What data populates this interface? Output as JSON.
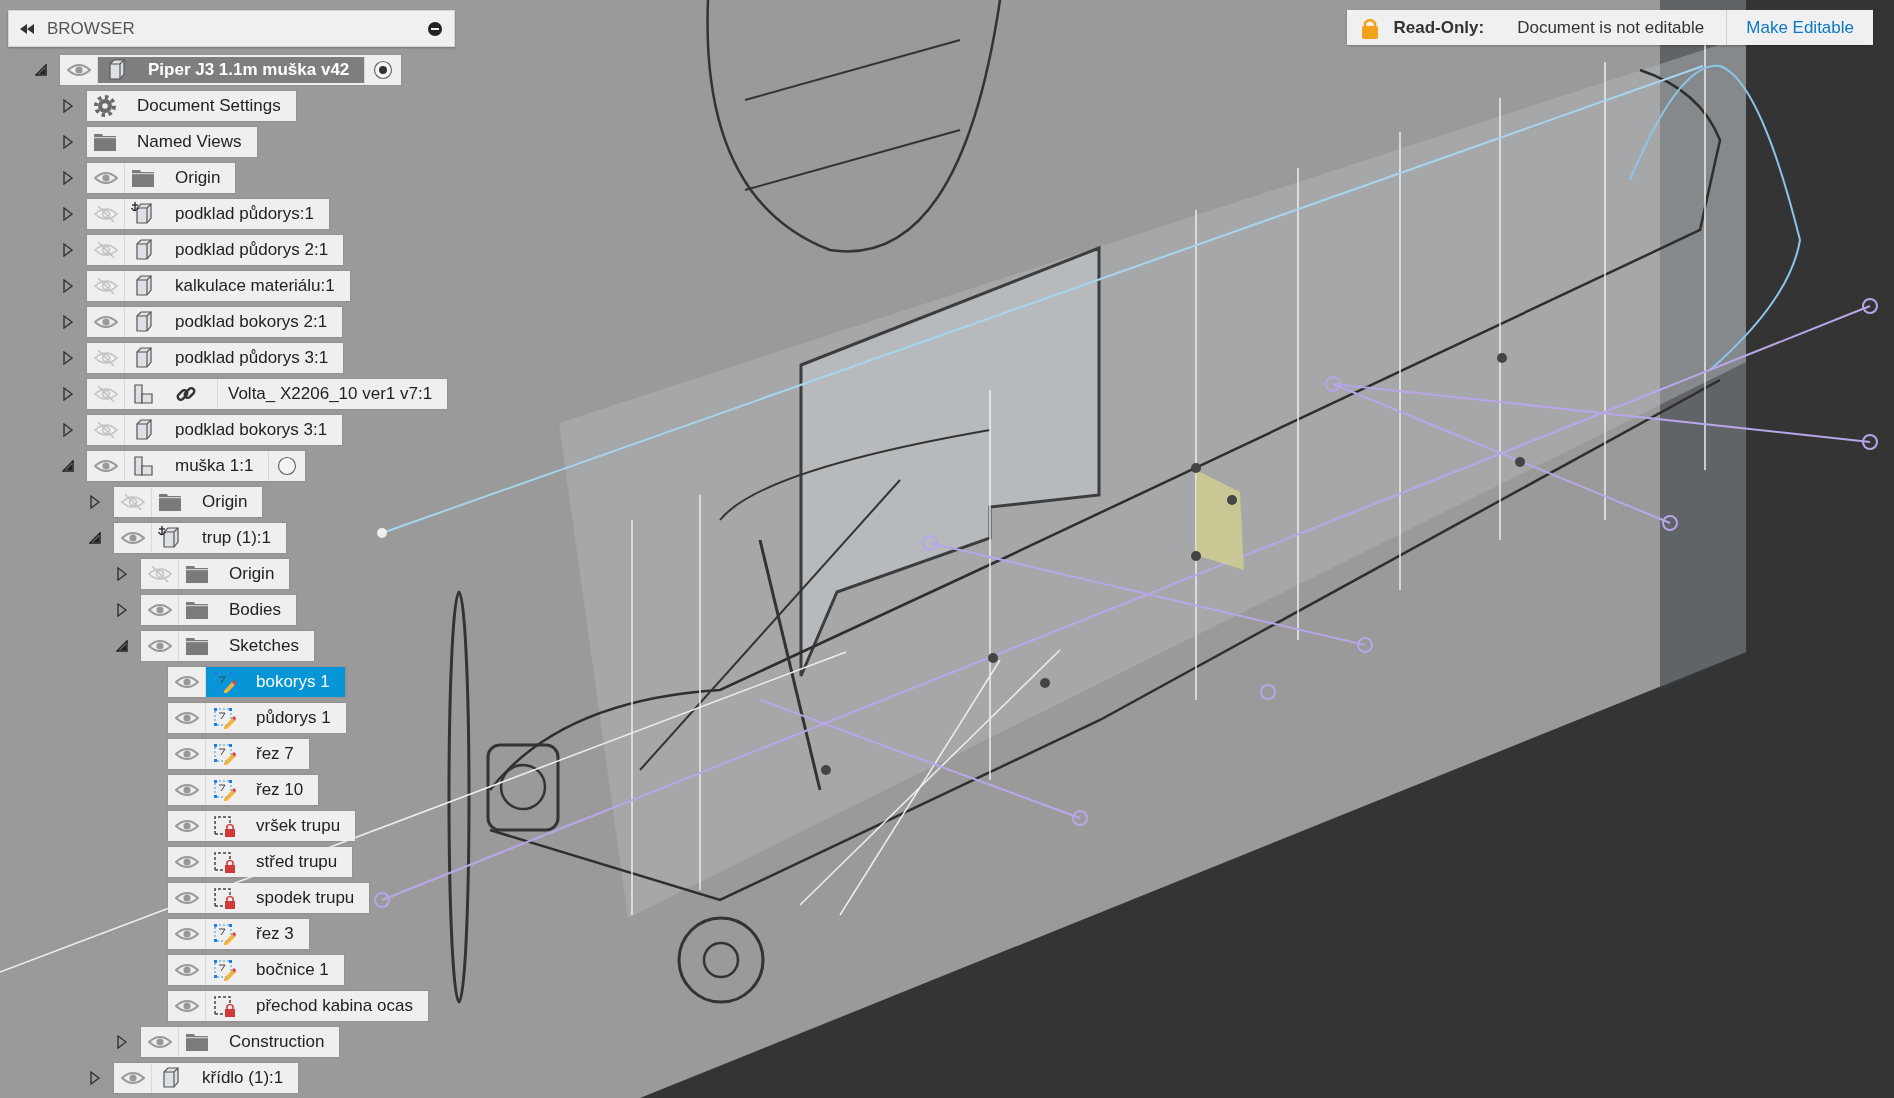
{
  "browser": {
    "title": "BROWSER",
    "tree": [
      {
        "label": "Piper J3 1.1m muška v42",
        "kind": "component",
        "visible": true,
        "expanded": true,
        "selected": false,
        "active": true,
        "children": [
          {
            "label": "Document Settings",
            "kind": "gear",
            "expanded": false,
            "selected": false
          },
          {
            "label": "Named Views",
            "kind": "folder",
            "expanded": false,
            "selected": false
          },
          {
            "label": "Origin",
            "kind": "folder",
            "visible": true,
            "expanded": false,
            "selected": false
          },
          {
            "label": "podklad půdorys:1",
            "kind": "component_anchored",
            "visible": false,
            "expanded": false,
            "selected": false
          },
          {
            "label": "podklad půdorys 2:1",
            "kind": "component",
            "visible": false,
            "expanded": false,
            "selected": false
          },
          {
            "label": "kalkulace materiálu:1",
            "kind": "component",
            "visible": false,
            "expanded": false,
            "selected": false
          },
          {
            "label": "podklad bokorys 2:1",
            "kind": "component",
            "visible": true,
            "expanded": false,
            "selected": false
          },
          {
            "label": "podklad půdorys 3:1",
            "kind": "component",
            "visible": false,
            "expanded": false,
            "selected": false
          },
          {
            "label": "Volta_ X2206_10 ver1 v7:1",
            "kind": "assembly",
            "linked": true,
            "visible": false,
            "expanded": false,
            "selected": false
          },
          {
            "label": "podklad bokorys 3:1",
            "kind": "component",
            "visible": false,
            "expanded": false,
            "selected": false
          },
          {
            "label": "muška 1:1",
            "kind": "assembly",
            "visible": true,
            "expanded": true,
            "selected": false,
            "active": false,
            "children": [
              {
                "label": "Origin",
                "kind": "folder",
                "visible": false,
                "expanded": false,
                "selected": false
              },
              {
                "label": "trup (1):1",
                "kind": "component_anchored",
                "visible": true,
                "expanded": true,
                "selected": false,
                "children": [
                  {
                    "label": "Origin",
                    "kind": "folder",
                    "visible": false,
                    "expanded": false,
                    "selected": false
                  },
                  {
                    "label": "Bodies",
                    "kind": "folder",
                    "visible": true,
                    "expanded": false,
                    "selected": false
                  },
                  {
                    "label": "Sketches",
                    "kind": "folder",
                    "visible": true,
                    "expanded": true,
                    "selected": false,
                    "children": [
                      {
                        "label": "bokorys 1",
                        "kind": "sketch",
                        "visible": true,
                        "selected": true
                      },
                      {
                        "label": "půdorys 1",
                        "kind": "sketch",
                        "visible": true,
                        "selected": false
                      },
                      {
                        "label": "řez 7",
                        "kind": "sketch",
                        "visible": true,
                        "selected": false
                      },
                      {
                        "label": "řez 10",
                        "kind": "sketch",
                        "visible": true,
                        "selected": false
                      },
                      {
                        "label": "vršek trupu",
                        "kind": "sketch_locked",
                        "visible": true,
                        "selected": false
                      },
                      {
                        "label": "střed trupu",
                        "kind": "sketch_locked",
                        "visible": true,
                        "selected": false
                      },
                      {
                        "label": "spodek trupu",
                        "kind": "sketch_locked",
                        "visible": true,
                        "selected": false
                      },
                      {
                        "label": "řez 3",
                        "kind": "sketch",
                        "visible": true,
                        "selected": false
                      },
                      {
                        "label": "bočnice 1",
                        "kind": "sketch",
                        "visible": true,
                        "selected": false
                      },
                      {
                        "label": "přechod kabina ocas",
                        "kind": "sketch_locked",
                        "visible": true,
                        "selected": false
                      }
                    ]
                  },
                  {
                    "label": "Construction",
                    "kind": "folder",
                    "visible": true,
                    "expanded": false,
                    "selected": false
                  }
                ]
              },
              {
                "label": "křídlo (1):1",
                "kind": "component",
                "visible": true,
                "expanded": false,
                "selected": false
              }
            ]
          }
        ]
      }
    ]
  },
  "notice": {
    "label": "Read-Only:",
    "message": "Document is not editable",
    "action": "Make Editable"
  }
}
